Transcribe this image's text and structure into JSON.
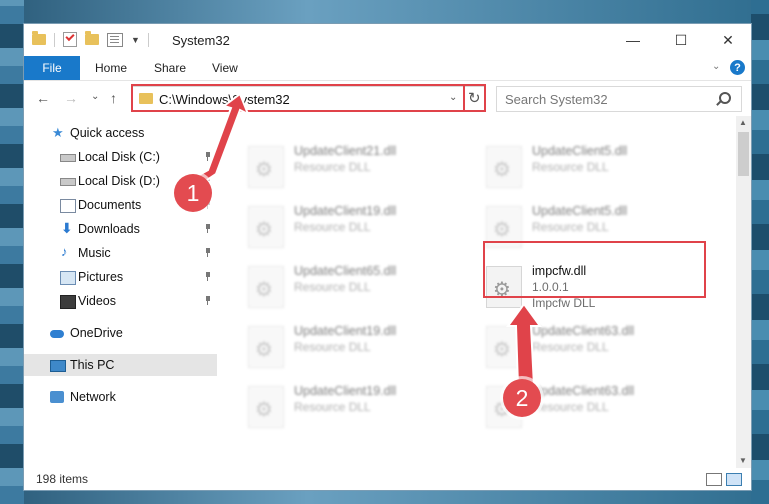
{
  "window": {
    "title": "System32",
    "minimize": "—",
    "maximize": "☐",
    "close": "✕"
  },
  "ribbon": {
    "tabs": [
      "File",
      "Home",
      "Share",
      "View"
    ],
    "collapse": "⌄",
    "help": "?"
  },
  "nav": {
    "back": "←",
    "forward": "→",
    "recent": "⌄",
    "up": "↑",
    "address": "C:\\Windows\\System32",
    "address_dropdown": "⌄",
    "refresh": "↻",
    "search_placeholder": "Search System32"
  },
  "sidebar": {
    "items": [
      {
        "label": "Quick access",
        "icon": "star-icon"
      },
      {
        "label": "Local Disk (C:)",
        "icon": "drive-icon"
      },
      {
        "label": "Local Disk (D:)",
        "icon": "drive-icon"
      },
      {
        "label": "Documents",
        "icon": "documents-icon"
      },
      {
        "label": "Downloads",
        "icon": "download-icon"
      },
      {
        "label": "Music",
        "icon": "music-icon"
      },
      {
        "label": "Pictures",
        "icon": "pictures-icon"
      },
      {
        "label": "Videos",
        "icon": "videos-icon"
      },
      {
        "label": "OneDrive",
        "icon": "cloud-icon"
      },
      {
        "label": "This PC",
        "icon": "computer-icon"
      },
      {
        "label": "Network",
        "icon": "network-icon"
      }
    ]
  },
  "files": [
    {
      "name": "UpdateClient21.dll",
      "type": "Resource DLL"
    },
    {
      "name": "UpdateClient5.dll",
      "type": "Resource DLL"
    },
    {
      "name": "UpdateClient19.dll",
      "type": "Resource DLL"
    },
    {
      "name": "UpdateClient5.dll",
      "type": "Resource DLL"
    },
    {
      "name": "UpdateClient65.dll",
      "type": "Resource DLL"
    },
    {
      "name": "impcfw.dll",
      "version": "1.0.0.1",
      "type": "Impcfw DLL"
    },
    {
      "name": "UpdateClient19.dll",
      "type": "Resource DLL"
    },
    {
      "name": "UpdateClient63.dll",
      "type": "Resource DLL"
    },
    {
      "name": "UpdateClient19.dll",
      "type": "Resource DLL"
    },
    {
      "name": "UpdateClient63.dll",
      "type": "Resource DLL"
    }
  ],
  "status": {
    "items_count": "198 items"
  },
  "annotations": {
    "step1": "1",
    "step2": "2",
    "color": "#e0434a"
  }
}
